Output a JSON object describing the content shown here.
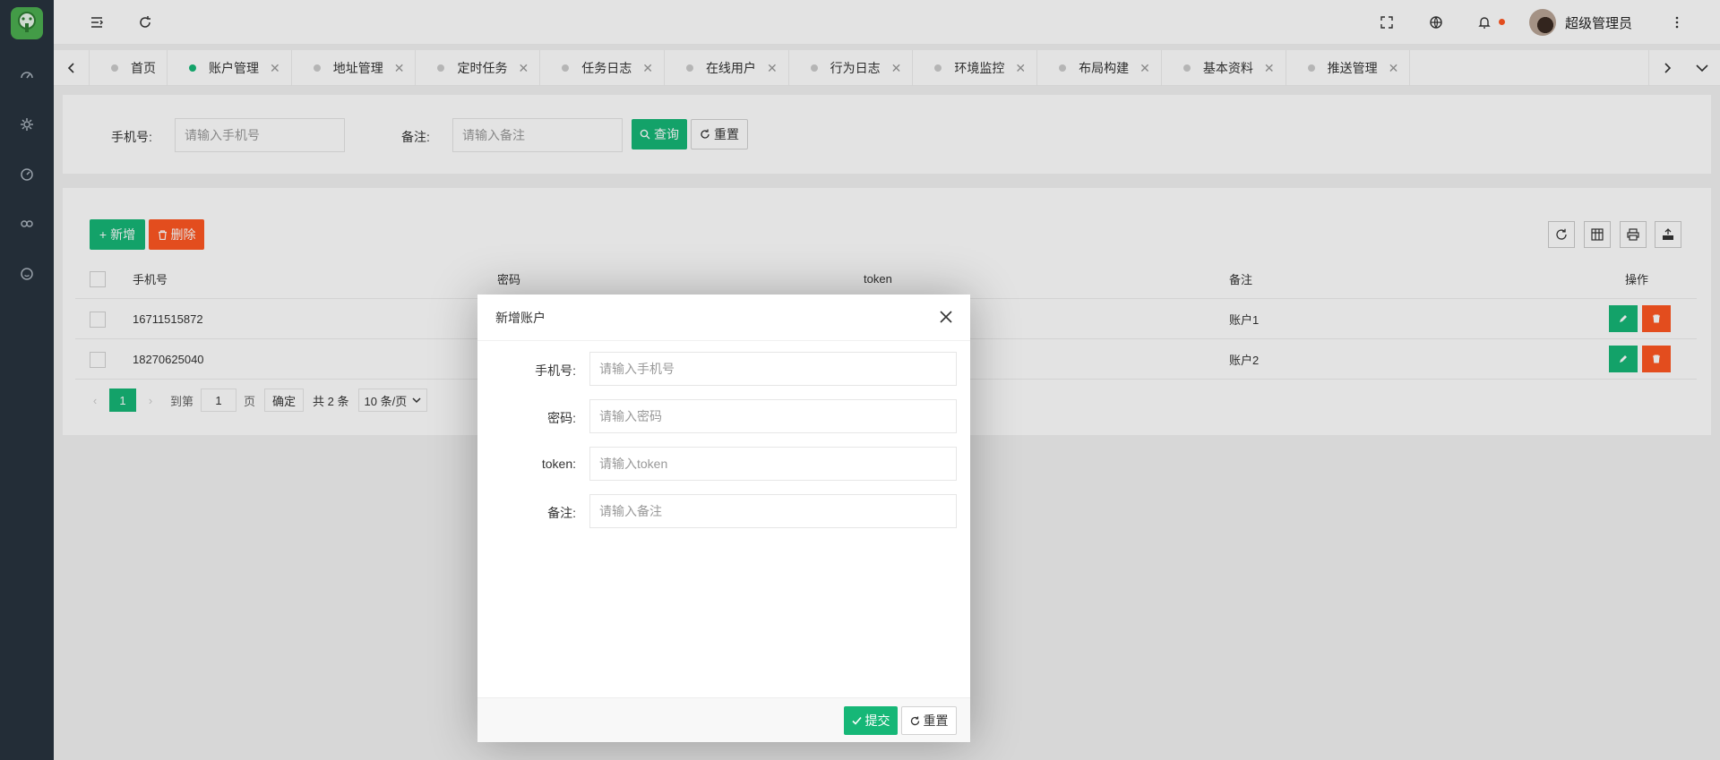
{
  "header": {
    "username": "超级管理员",
    "icons": [
      "menu-toggle-icon",
      "refresh-icon",
      "fullscreen-icon",
      "globe-icon",
      "bell-icon",
      "more-vertical-icon"
    ]
  },
  "sidebar": {
    "icons": [
      "dashboard-icon",
      "settings-icon",
      "gauge-icon",
      "link-icon",
      "smile-icon"
    ]
  },
  "tabs": [
    {
      "label": "首页",
      "closable": false,
      "active": false
    },
    {
      "label": "账户管理",
      "closable": true,
      "active": true
    },
    {
      "label": "地址管理",
      "closable": true,
      "active": false
    },
    {
      "label": "定时任务",
      "closable": true,
      "active": false
    },
    {
      "label": "任务日志",
      "closable": true,
      "active": false
    },
    {
      "label": "在线用户",
      "closable": true,
      "active": false
    },
    {
      "label": "行为日志",
      "closable": true,
      "active": false
    },
    {
      "label": "环境监控",
      "closable": true,
      "active": false
    },
    {
      "label": "布局构建",
      "closable": true,
      "active": false
    },
    {
      "label": "基本资料",
      "closable": true,
      "active": false
    },
    {
      "label": "推送管理",
      "closable": true,
      "active": false
    }
  ],
  "search": {
    "phone_label": "手机号:",
    "phone_placeholder": "请输入手机号",
    "remark_label": "备注:",
    "remark_placeholder": "请输入备注",
    "query_label": "查询",
    "reset_label": "重置"
  },
  "toolbar": {
    "add_label": "新增",
    "delete_label": "删除"
  },
  "table": {
    "columns": [
      "手机号",
      "密码",
      "token",
      "备注",
      "操作"
    ],
    "rows": [
      {
        "phone": "16711515872",
        "remark": "账户1"
      },
      {
        "phone": "18270625040",
        "remark": "账户2"
      }
    ]
  },
  "pager": {
    "current_page": "1",
    "goto_label": "到第",
    "goto_value": "1",
    "page_unit": "页",
    "confirm_label": "确定",
    "total": "共 2 条",
    "page_size": "10 条/页"
  },
  "modal": {
    "title": "新增账户",
    "fields": [
      {
        "label": "手机号:",
        "placeholder": "请输入手机号"
      },
      {
        "label": "密码:",
        "placeholder": "请输入密码"
      },
      {
        "label": "token:",
        "placeholder": "请输入token"
      },
      {
        "label": "备注:",
        "placeholder": "请输入备注"
      }
    ],
    "submit_label": "提交",
    "reset_label": "重置"
  },
  "colors": {
    "primary_green": "#16b777",
    "danger_red": "#ff5722",
    "sidebar_bg": "#28333e"
  }
}
